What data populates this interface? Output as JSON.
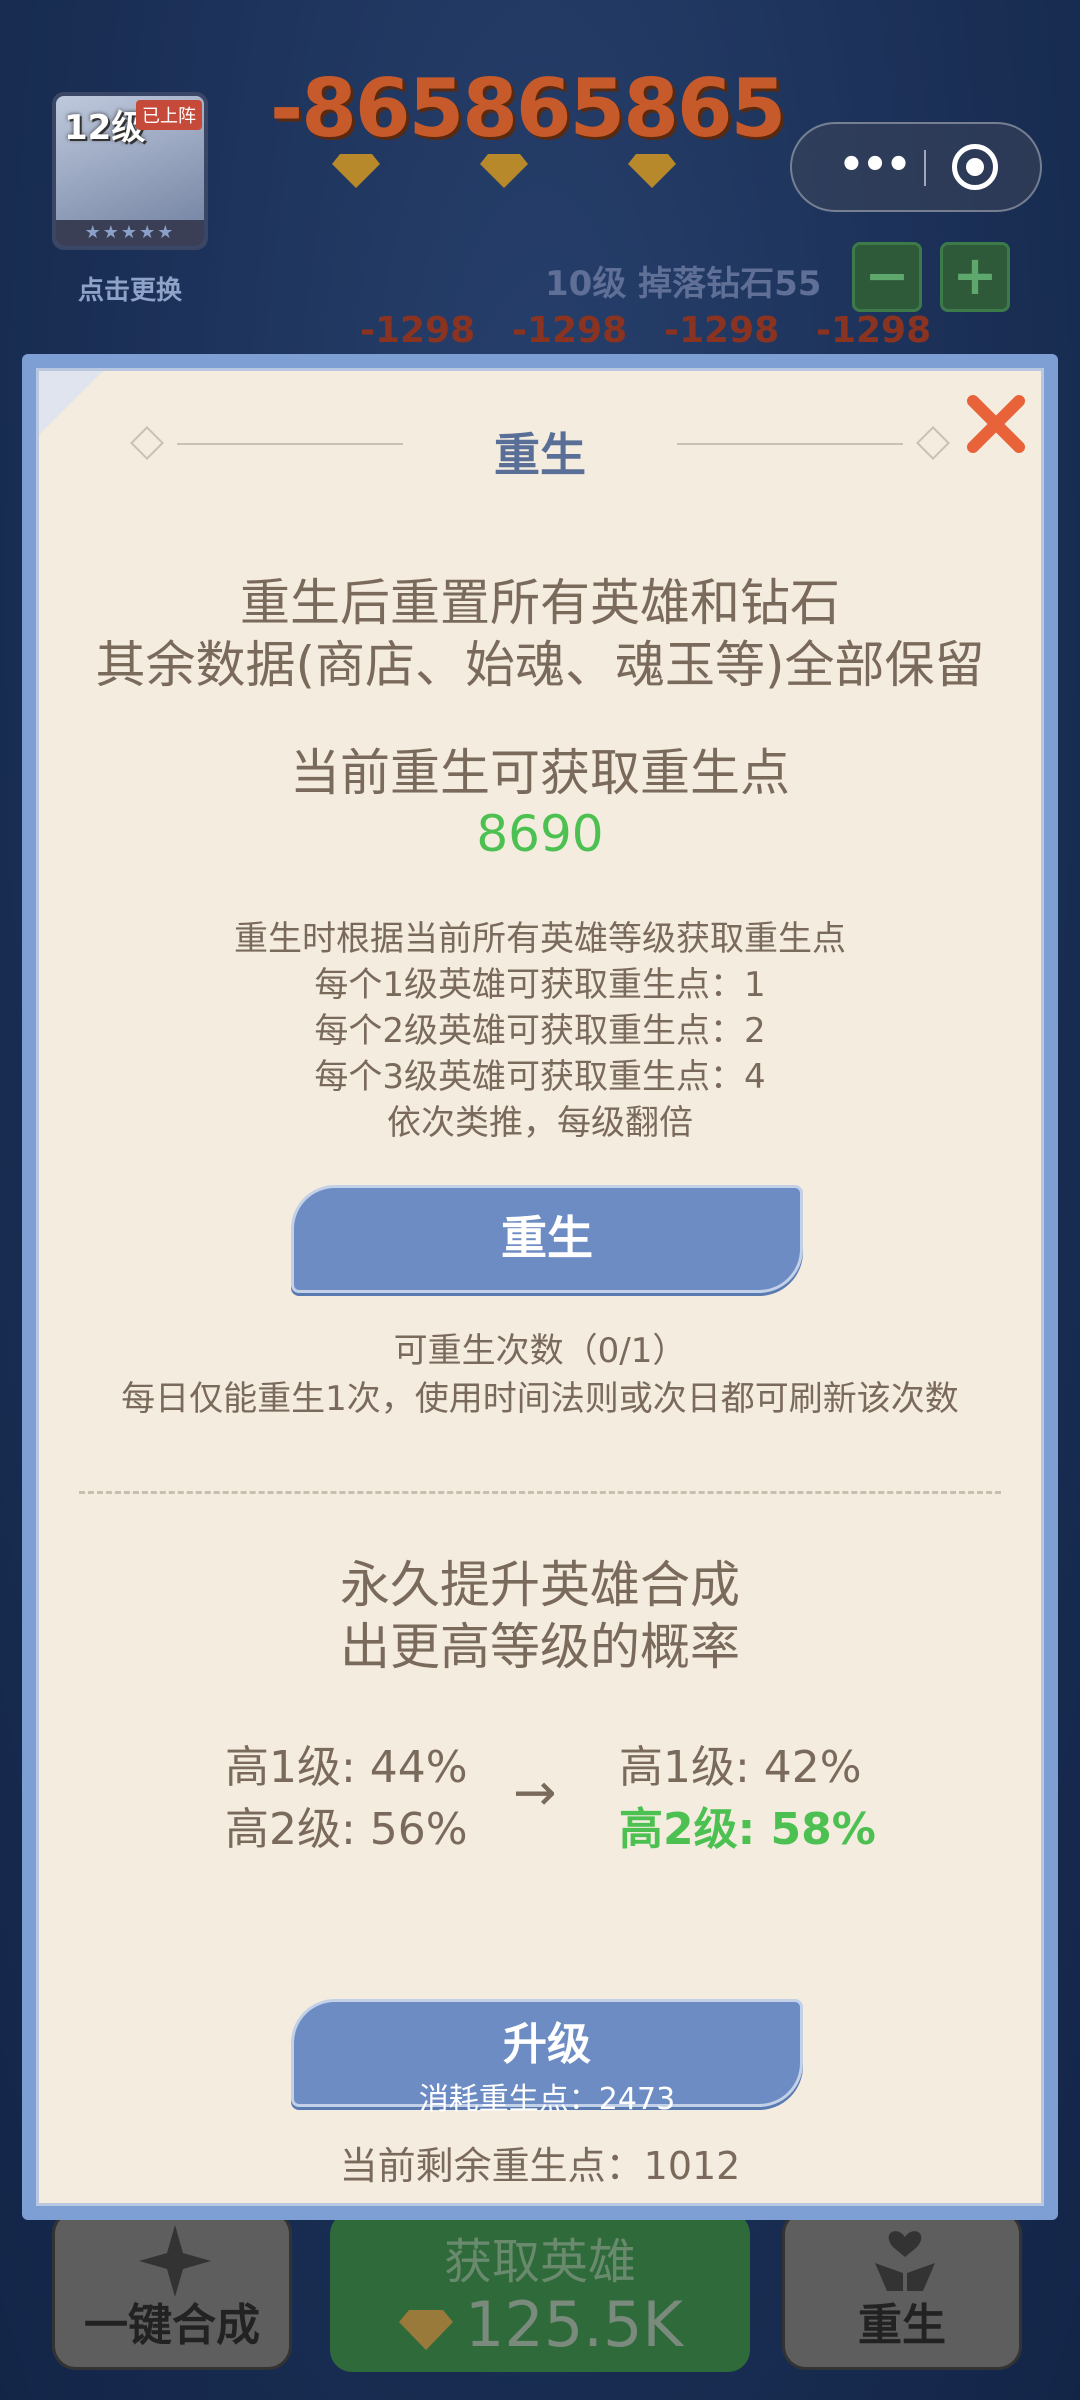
{
  "background": {
    "hero_card": {
      "level": "12级",
      "tag": "已上阵",
      "stars": "★★★★★"
    },
    "change_label": "点击更换",
    "score": "-865865865",
    "drop_info": "10级 掉落钻石55",
    "minus_label": "−",
    "plus_label": "+",
    "damage_numbers": [
      "-1298",
      "-1298",
      "-1298",
      "-1298"
    ],
    "capsule": {
      "more_label": "•••"
    },
    "bottom_bar": {
      "left_label": "一键合成",
      "center_title": "获取英雄",
      "center_value": "125.5K",
      "right_label": "重生"
    }
  },
  "modal": {
    "title": "重生",
    "intro_line1": "重生后重置所有英雄和钻石",
    "intro_line2": "其余数据(商店、始魂、魂玉等)全部保留",
    "current_points_label": "当前重生可获取重生点",
    "current_points_value": "8690",
    "rules": [
      "重生时根据当前所有英雄等级获取重生点",
      "每个1级英雄可获取重生点：1",
      "每个2级英雄可获取重生点：2",
      "每个3级英雄可获取重生点：4",
      "依次类推，每级翻倍"
    ],
    "rebirth_button": "重生",
    "remaining_count": "可重生次数（0/1）",
    "daily_note": "每日仅能重生1次，使用时间法则或次日都可刷新该次数",
    "upgrade_title_line1": "永久提升英雄合成",
    "upgrade_title_line2": "出更高等级的概率",
    "current_prob": [
      "高1级: 44%",
      "高2级: 56%"
    ],
    "arrow": "→",
    "next_prob": [
      "高1级: 42%",
      "高2级: 58%"
    ],
    "upgrade_button": "升级",
    "upgrade_cost": "消耗重生点：2473",
    "remaining_points": "当前剩余重生点：1012"
  },
  "colors": {
    "modal_bg": "#f4ecdf",
    "modal_border": "#7e9fd4",
    "button_blue": "#6d8cc4",
    "accent_green": "#4cc152",
    "text_brown": "#7a6a5c",
    "close_orange": "#e8623a"
  }
}
